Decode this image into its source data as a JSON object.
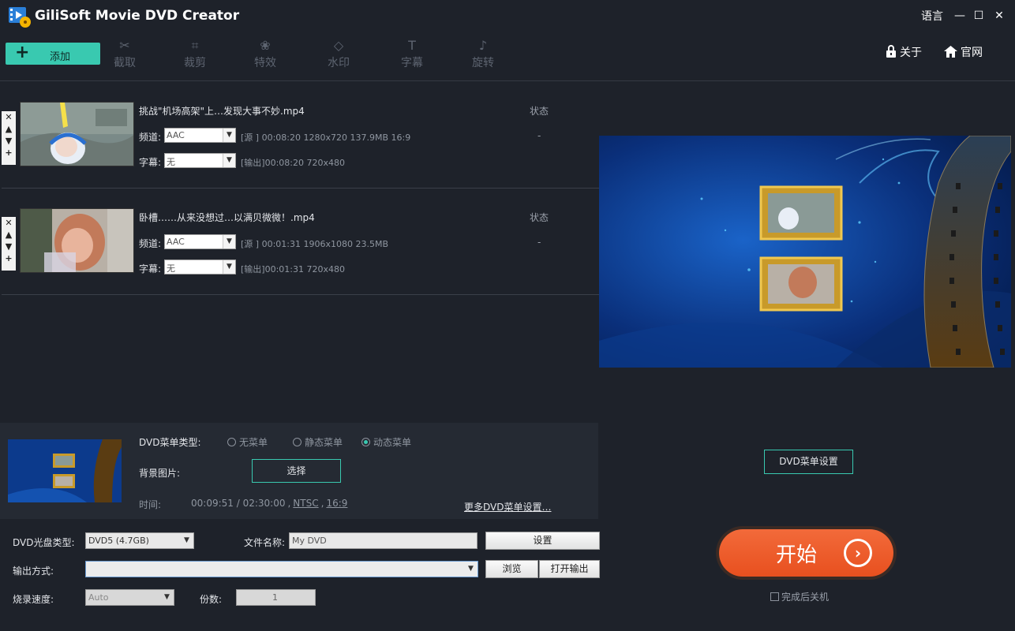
{
  "app": {
    "title": "GiliSoft Movie DVD Creator",
    "language_label": "语言"
  },
  "window_controls": {
    "minimize": "—",
    "maximize": "☐",
    "close": "✕"
  },
  "toolbar": {
    "add_label": "添加",
    "tools": [
      {
        "label": "截取",
        "icon": "scissors-icon",
        "glyph": "✂"
      },
      {
        "label": "裁剪",
        "icon": "crop-icon",
        "glyph": "⌗"
      },
      {
        "label": "特效",
        "icon": "effects-icon",
        "glyph": "❀"
      },
      {
        "label": "水印",
        "icon": "watermark-icon",
        "glyph": "◇"
      },
      {
        "label": "字幕",
        "icon": "subtitle-icon",
        "glyph": "T"
      },
      {
        "label": "旋转",
        "icon": "rotate-icon",
        "glyph": "♪"
      }
    ],
    "about_label": "关于",
    "website_label": "官网"
  },
  "files": [
    {
      "name": "挑战\"机场高架\"上…发现大事不妙.mp4",
      "status_label": "状态",
      "status_value": "-",
      "audio_label": "频道:",
      "audio_value": "AAC",
      "subtitle_label": "字幕:",
      "subtitle_value": "无",
      "source_info": "[源 ]  00:08:20   1280x720   137.9MB   16:9",
      "output_info": "[输出]00:08:20   720x480"
    },
    {
      "name": "卧槽……从来没想过…以满贝微微！.mp4",
      "status_label": "状态",
      "status_value": "-",
      "audio_label": "频道:",
      "audio_value": "AAC",
      "subtitle_label": "字幕:",
      "subtitle_value": "无",
      "source_info": "[源 ]  00:01:31   1906x1080   23.5MB",
      "output_info": "[输出]00:01:31   720x480"
    }
  ],
  "menu_panel": {
    "type_label": "DVD菜单类型:",
    "options": [
      "无菜单",
      "静态菜单",
      "动态菜单"
    ],
    "selected": "动态菜单",
    "bg_label": "背景图片:",
    "choose_button": "选择",
    "time_label": "时间:",
    "time_value": "00:09:51 / 02:30:00",
    "format_ntsc": "NTSC",
    "format_ratio": "16:9",
    "more_link": "更多DVD菜单设置…",
    "sep": ","
  },
  "dvd_settings_button": "DVD菜单设置",
  "form": {
    "disc_type_label": "DVD光盘类型:",
    "disc_type_value": "DVD5 (4.7GB)",
    "filename_label": "文件名称:",
    "filename_value": "My DVD",
    "settings_button": "设置",
    "output_label": "输出方式:",
    "output_value": "",
    "browse_button": "浏览",
    "open_output_button": "打开输出",
    "speed_label": "烧录速度:",
    "speed_value": "Auto",
    "copies_label": "份数:",
    "copies_value": "1"
  },
  "start": {
    "label": "开始",
    "arrow": "›"
  },
  "shutdown_label": "完成后关机",
  "colors": {
    "accent": "#39c9b0",
    "start": "#f0602e",
    "background": "#1e222a"
  }
}
